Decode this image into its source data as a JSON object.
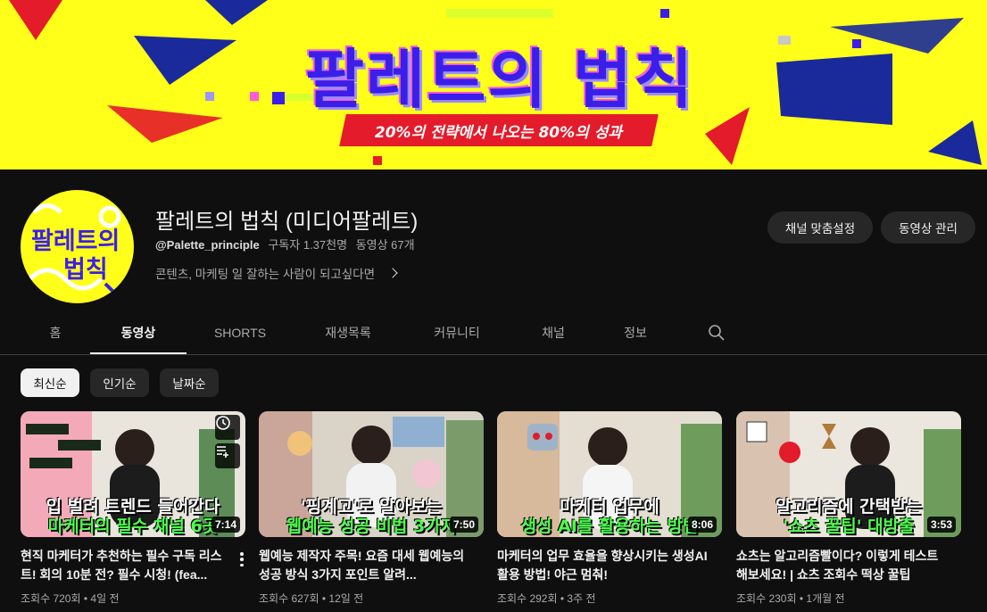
{
  "banner": {
    "title": "팔레트의 법칙",
    "subtitle": "20%의 전략에서 나오는 80%의 성과"
  },
  "avatar": {
    "line1": "팔레트의",
    "line2": "법칙"
  },
  "channel": {
    "name": "팔레트의 법칙 (미디어팔레트)",
    "handle": "@Palette_principle",
    "subscribers": "구독자 1.37천명",
    "videos": "동영상 67개",
    "description": "콘텐츠, 마케팅 일 잘하는 사람이 되고싶다면"
  },
  "actions": {
    "customize": "채널 맞춤설정",
    "manage": "동영상 관리"
  },
  "tabs": [
    "홈",
    "동영상",
    "SHORTS",
    "재생목록",
    "커뮤니티",
    "채널",
    "정보"
  ],
  "chips": [
    "최신순",
    "인기순",
    "날짜순"
  ],
  "videos": [
    {
      "caption1": "입 벌려 트렌드 들어간다",
      "caption2": "마케터의 필수 채널 6곳",
      "duration": "7:14",
      "title": "현직 마케터가 추천하는 필수 구독 리스트! 회의 10분 전? 필수 시청! (fea...",
      "views": "조회수 720회",
      "age": "4일 전"
    },
    {
      "caption1": "'핑계고'로 알아보는",
      "caption2": "웹예능 성공 비법 3가지",
      "duration": "7:50",
      "title": "웹예능 제작자 주목! 요즘 대세 웹예능의 성공 방식 3가지 포인트 알려...",
      "views": "조회수 627회",
      "age": "12일 전"
    },
    {
      "caption1": "마케터 업무에",
      "caption2": "생성 AI를 활용하는 방법",
      "duration": "8:06",
      "title": "마케터의 업무 효율을 향상시키는 생성AI 활용 방법! 야근 멈춰!",
      "views": "조회수 292회",
      "age": "3주 전"
    },
    {
      "caption1": "알고리즘에 간택받는",
      "caption2": "'쇼츠 꿀팁' 대방출",
      "duration": "3:53",
      "title": "쇼츠는 알고리즘빨이다? 이렇게 테스트해보세요! | 쇼츠 조회수 떡상 꿀팁",
      "views": "조회수 230회",
      "age": "1개월 전"
    }
  ],
  "colors": {
    "banner_bg": "#ffff1a",
    "brand_blue": "#3b1fe8",
    "accent_red": "#e41b2a",
    "caption_green": "#4dff4d"
  }
}
